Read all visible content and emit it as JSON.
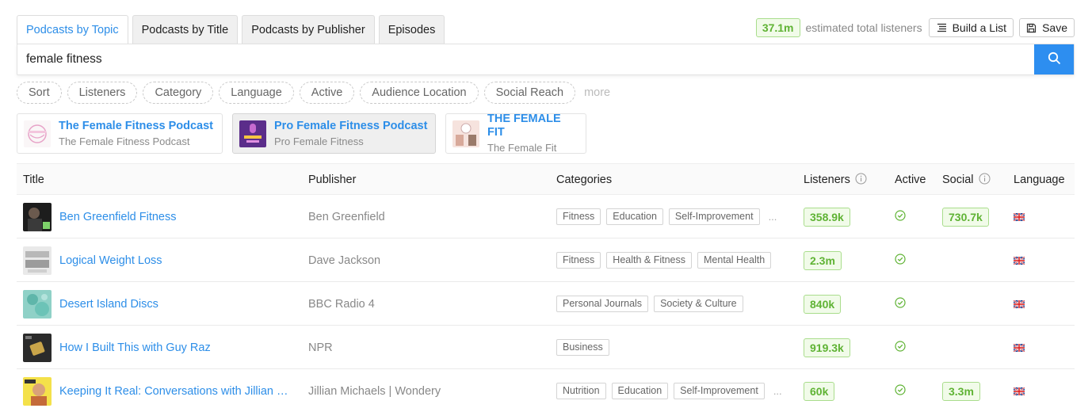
{
  "tabs": [
    {
      "label": "Podcasts by Topic",
      "active": true
    },
    {
      "label": "Podcasts by Title",
      "active": false
    },
    {
      "label": "Podcasts by Publisher",
      "active": false
    },
    {
      "label": "Episodes",
      "active": false
    }
  ],
  "header": {
    "listeners_value": "37.1m",
    "listeners_label": "estimated total listeners",
    "build_list_label": "Build a List",
    "save_label": "Save"
  },
  "search": {
    "value": "female fitness",
    "icon": "search-icon"
  },
  "filters": [
    "Sort",
    "Listeners",
    "Category",
    "Language",
    "Active",
    "Audience Location",
    "Social Reach"
  ],
  "filters_more": "more",
  "suggestions": [
    {
      "title": "The Female Fitness Podcast",
      "subtitle": "The Female Fitness Podcast",
      "selected": false
    },
    {
      "title": "Pro Female Fitness Podcast",
      "subtitle": "Pro Female Fitness",
      "selected": true
    },
    {
      "title": "THE FEMALE FIT",
      "subtitle": "The Female Fit",
      "selected": false
    }
  ],
  "table": {
    "headers": {
      "title": "Title",
      "publisher": "Publisher",
      "categories": "Categories",
      "listeners": "Listeners",
      "active": "Active",
      "social": "Social",
      "language": "Language"
    },
    "rows": [
      {
        "title": "Ben Greenfield Fitness",
        "publisher": "Ben Greenfield",
        "categories": [
          "Fitness",
          "Education",
          "Self-Improvement"
        ],
        "more_categories": "...",
        "listeners": "358.9k",
        "active": true,
        "social": "730.7k",
        "language": "uk-flag-icon"
      },
      {
        "title": "Logical Weight Loss",
        "publisher": "Dave Jackson",
        "categories": [
          "Fitness",
          "Health & Fitness",
          "Mental Health"
        ],
        "more_categories": "",
        "listeners": "2.3m",
        "active": true,
        "social": "",
        "language": "uk-flag-icon"
      },
      {
        "title": "Desert Island Discs",
        "publisher": "BBC Radio 4",
        "categories": [
          "Personal Journals",
          "Society & Culture"
        ],
        "more_categories": "",
        "listeners": "840k",
        "active": true,
        "social": "",
        "language": "uk-flag-icon"
      },
      {
        "title": "How I Built This with Guy Raz",
        "publisher": "NPR",
        "categories": [
          "Business"
        ],
        "more_categories": "",
        "listeners": "919.3k",
        "active": true,
        "social": "",
        "language": "uk-flag-icon"
      },
      {
        "title": "Keeping It Real: Conversations with Jillian Michaels",
        "publisher": "Jillian Michaels | Wondery",
        "categories": [
          "Nutrition",
          "Education",
          "Self-Improvement"
        ],
        "more_categories": "...",
        "listeners": "60k",
        "active": true,
        "social": "3.3m",
        "language": "uk-flag-icon"
      }
    ]
  },
  "colors": {
    "accent": "#2d8ee8",
    "search_button": "#2d8ef0",
    "metric_green": "#5fb334",
    "metric_bg": "#f1fbe9",
    "metric_border": "#a9dd8c"
  }
}
